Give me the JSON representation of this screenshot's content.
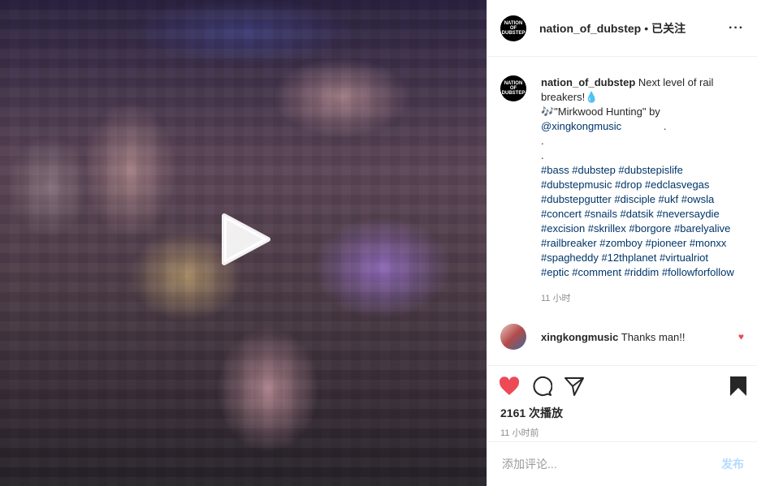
{
  "post": {
    "username": "nation_of_dubstep",
    "dot": "•",
    "follow_status": "已关注",
    "more": "···",
    "logo_text": "NATION OF DUBSTEP"
  },
  "caption": {
    "username": "nation_of_dubstep",
    "text": "Next level of rail breakers!💧",
    "song_line": "🎶\"Mirkwood Hunting\" by",
    "mention": "@xingkongmusic",
    "dot1": ".",
    "dot2": ".",
    "dot3": ".",
    "hashtags": "#bass #dubstep #dubstepislife #dubstepmusic #drop #edclasvegas #dubstepgutter #disciple #ukf #owsla #concert #snails #datsik #neversaydie #excision #skrillex #borgore #barelyalive #railbreaker #zomboy #pioneer #monxx #spagheddy #12thplanet #virtualriot #eptic #comment #riddim #followforfollow",
    "time": "11 小时"
  },
  "reply": {
    "username": "xingkongmusic",
    "text": "Thanks man!!"
  },
  "stats": {
    "views": "2161 次播放",
    "ago": "11 小时前"
  },
  "comment_box": {
    "placeholder": "添加评论...",
    "post_label": "发布"
  },
  "colors": {
    "like": "#ed4956",
    "link": "#003569",
    "post_disabled": "#b3dbff"
  },
  "icons": {
    "like": "heart-icon",
    "comment": "comment-icon",
    "share": "share-icon",
    "save": "bookmark-icon",
    "play": "play-icon"
  }
}
